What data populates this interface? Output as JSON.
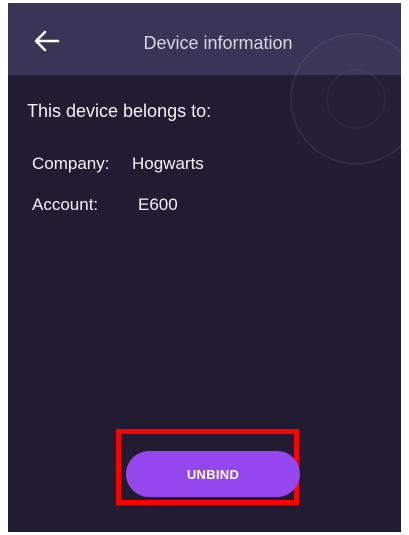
{
  "header": {
    "title": "Device information",
    "back_icon": "arrow-left-icon"
  },
  "main": {
    "belongs_text": "This device belongs to:",
    "company_label": "Company:",
    "company_value": "Hogwarts",
    "account_label": "Account:",
    "account_value": "E600"
  },
  "footer": {
    "unbind_label": "UNBIND"
  },
  "colors": {
    "background": "#221c33",
    "header": "#3a3456",
    "accent": "#9547ee",
    "highlight": "#ff0000"
  }
}
